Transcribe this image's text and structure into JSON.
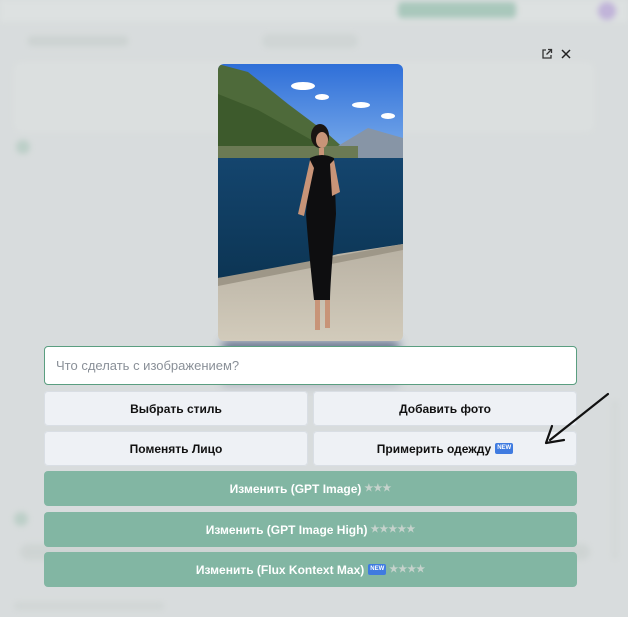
{
  "modal": {
    "prompt_placeholder": "Что сделать с изображением?",
    "buttons": {
      "choose_style": "Выбрать стиль",
      "add_photo": "Добавить фото",
      "change_face": "Поменять Лицо",
      "try_on_clothes": "Примерить одежду",
      "edit_gpt_image": "Изменить (GPT Image)",
      "edit_gpt_image_high": "Изменить (GPT Image High)",
      "edit_flux_kontext_max": "Изменить (Flux Kontext Max)"
    },
    "badge_new": "NEW",
    "stars": {
      "gpt_image": "★★★",
      "gpt_image_high": "★★★★★",
      "flux_kontext_max": "★★★★"
    },
    "icons": {
      "open_external": "external-link-icon",
      "close": "close-icon"
    }
  },
  "colors": {
    "accent_green": "#82b6a3",
    "input_border": "#5a9e80",
    "badge_blue": "#3f7be0"
  }
}
